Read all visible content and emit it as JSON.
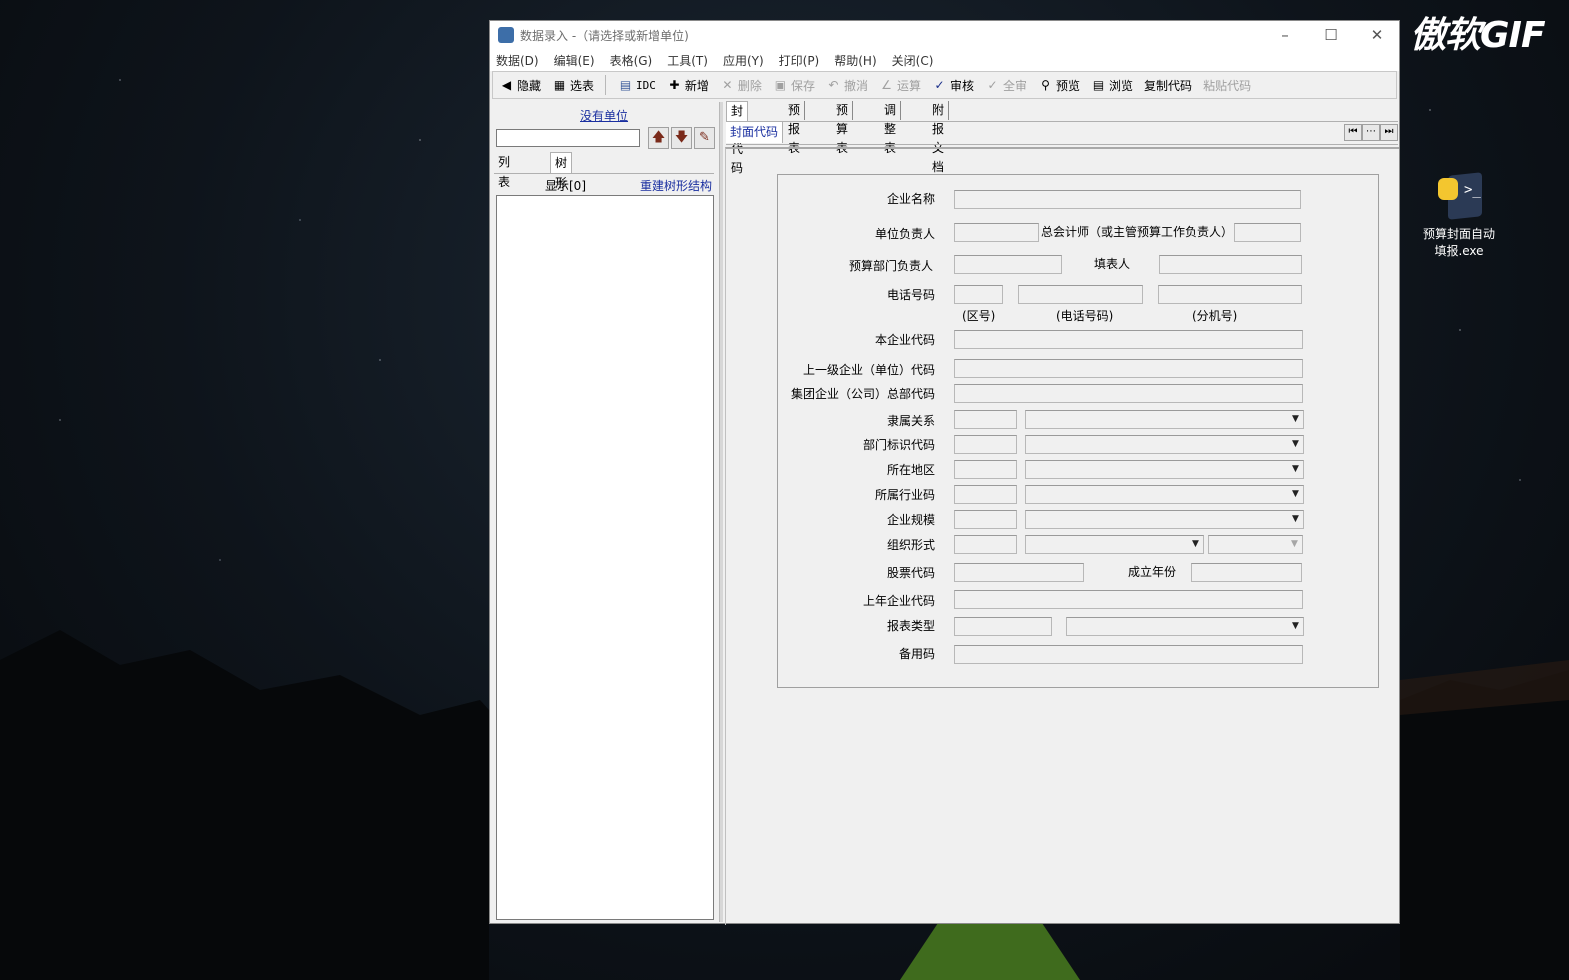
{
  "watermark": "傲软GIF",
  "desktop_icon": {
    "label": "预算封面自动填报.exe"
  },
  "window": {
    "title": "数据录入 -（请选择或新增单位)",
    "menu": [
      "数据(D)",
      "编辑(E)",
      "表格(G)",
      "工具(T)",
      "应用(Y)",
      "打印(P)",
      "帮助(H)",
      "关闭(C)"
    ],
    "toolbar": {
      "hide": "隐藏",
      "select_table": "选表",
      "idc": "IDC",
      "add": "新增",
      "delete": "删除",
      "save": "保存",
      "cancel": "撤消",
      "calc": "运算",
      "audit": "审核",
      "full_audit": "全审",
      "preview": "预览",
      "browse": "浏览",
      "copy_code": "复制代码",
      "paste_code": "粘贴代码"
    }
  },
  "left_panel": {
    "no_unit": "没有单位",
    "tabs": [
      "列表查看",
      "树形结构"
    ],
    "display": "显示[0]",
    "rebuild": "重建树形结构"
  },
  "right_panel": {
    "tabs": [
      "封面代码",
      "预报表",
      "预算表",
      "调整表",
      "附报文档"
    ],
    "subtab": "封面代码"
  },
  "form": {
    "company_name": "企业名称",
    "unit_head": "单位负责人",
    "chief_accountant": "总会计师（或主管预算工作负责人）",
    "budget_dept_head": "预算部门负责人",
    "filler": "填表人",
    "phone": "电话号码",
    "area_code": "(区号)",
    "phone_number": "(电话号码)",
    "extension": "(分机号)",
    "company_code": "本企业代码",
    "parent_code": "上一级企业（单位）代码",
    "group_hq_code": "集团企业（公司）总部代码",
    "affiliation": "隶属关系",
    "dept_id_code": "部门标识代码",
    "location": "所在地区",
    "industry_code": "所属行业码",
    "company_scale": "企业规模",
    "org_form": "组织形式",
    "stock_code": "股票代码",
    "founded_year": "成立年份",
    "last_year_code": "上年企业代码",
    "report_type": "报表类型",
    "backup_code": "备用码"
  }
}
